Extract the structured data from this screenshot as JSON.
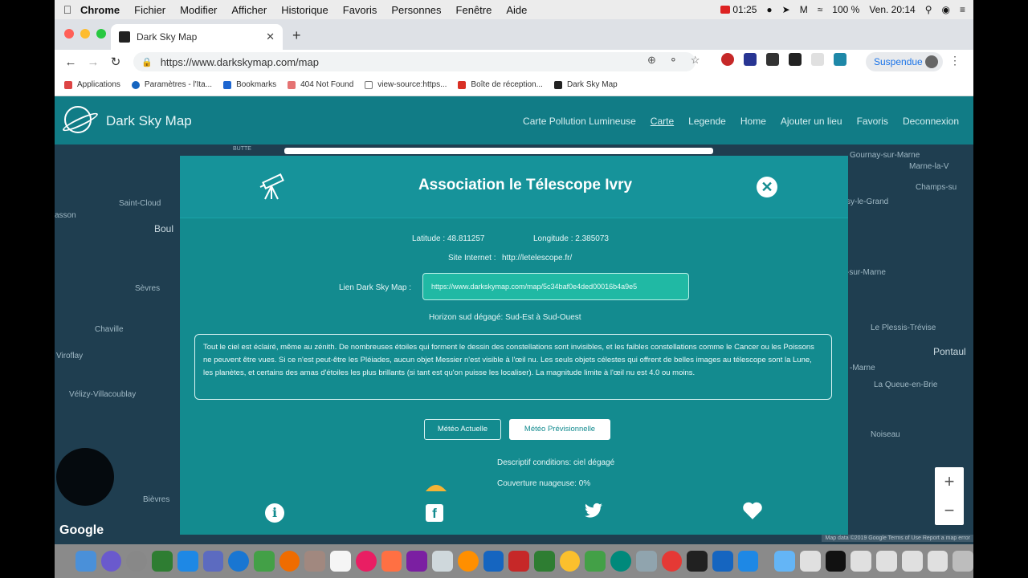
{
  "menubar": {
    "items": [
      "Chrome",
      "Fichier",
      "Modifier",
      "Afficher",
      "Historique",
      "Favoris",
      "Personnes",
      "Fenêtre",
      "Aide"
    ],
    "record_time": "01:25",
    "battery": "100 %",
    "clock": "Ven. 20:14"
  },
  "browser": {
    "tab_title": "Dark Sky Map",
    "url": "https://www.darkskymap.com/map",
    "profile_label": "Suspendue"
  },
  "bookmarks": [
    "Applications",
    "Paramètres - l'Ita...",
    "Bookmarks",
    "404 Not Found",
    "view-source:https...",
    "Boîte de réception...",
    "Dark Sky Map"
  ],
  "site": {
    "brand": "Dark Sky Map",
    "nav": [
      "Carte Pollution Lumineuse",
      "Carte",
      "Legende",
      "Home",
      "Ajouter un lieu",
      "Favoris",
      "Deconnexion"
    ]
  },
  "map": {
    "towns": [
      "Saint-Cloud",
      "Boul",
      "Sèvres",
      "Chaville",
      "Viroflay",
      "Vélizy-Villacoublay",
      "Bièvres",
      "Gournay-sur-Marne",
      "Marne-la-V",
      "Champs-su",
      "sy-le-Grand",
      "-sur-Marne",
      "Le Plessis-Trévise",
      "Pontaul",
      "-Marne",
      "La Queue-en-Brie",
      "Noiseau",
      "asson",
      "BUTTE"
    ],
    "google": "Google",
    "terms": "Map data ©2019 Google   Terms of Use   Report a map error",
    "zoom_in": "+",
    "zoom_out": "−"
  },
  "modal": {
    "title": "Association le Télescope Ivry",
    "latitude": "Latitude : 48.811257",
    "longitude": "Longitude : 2.385073",
    "site_label": "Site Internet :",
    "site_url": "http://letelescope.fr/",
    "link_label": "Lien Dark Sky Map :",
    "link_url": "https://www.darkskymap.com/map/5c34baf0e4ded00016b4a9e5",
    "horizon": "Horizon sud dégagé: Sud-Est à Sud-Ouest",
    "description": "Tout le ciel est éclairé, même au zénith. De nombreuses étoiles qui forment le dessin des constellations sont invisibles, et les faibles constellations comme le Cancer ou les Poissons ne peuvent être vues. Si ce n'est peut-être les Pléiades, aucun objet Messier n'est visible à l'œil nu. Les seuls objets célestes qui offrent de belles images au télescope sont la Lune, les planètes, et certains des amas d'étoiles les plus brillants (si tant est qu'on puisse les localiser). La magnitude limite à l'œil nu est 4.0 ou moins.",
    "btn_current": "Météo Actuelle",
    "btn_forecast": "Météo Prévisionnelle",
    "conditions": "Descriptif conditions: ciel dégagé",
    "clouds": "Couverture nuageuse: 0%"
  },
  "colors": {
    "site_nav": "#117c86",
    "modal_bg": "#138b8f",
    "map_bg": "#1f3e50"
  }
}
